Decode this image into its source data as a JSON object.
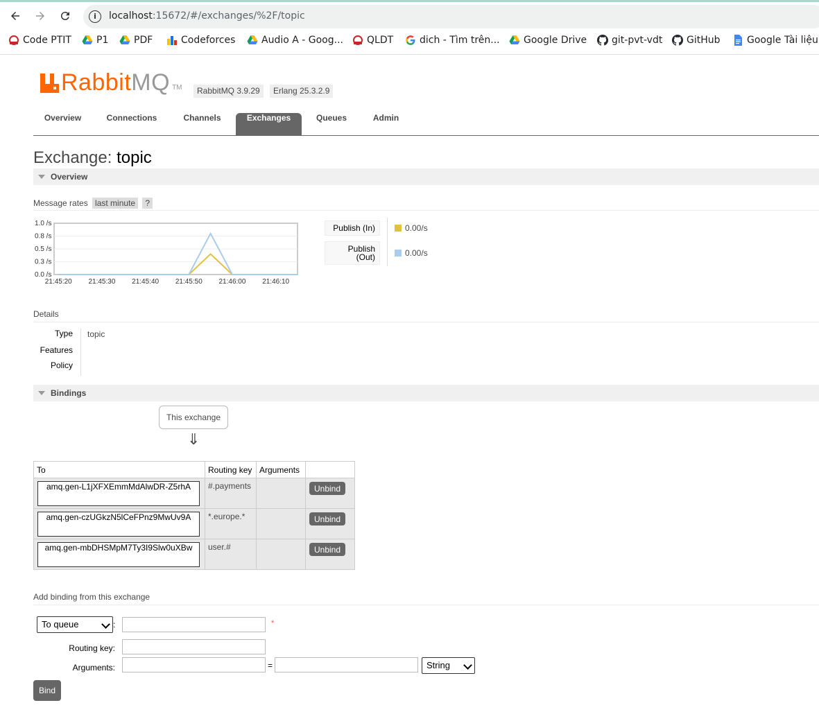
{
  "browser": {
    "url_host": "localhost",
    "url_rest": ":15672/#/exchanges/%2F/topic",
    "bookmarks": [
      {
        "label": "Code PTIT",
        "icon": "ptit-icon"
      },
      {
        "label": "P1",
        "icon": "google-drive-icon"
      },
      {
        "label": "PDF",
        "icon": "google-drive-icon"
      },
      {
        "label": "Codeforces",
        "icon": "codeforces-icon"
      },
      {
        "label": "Audio A - Goog...",
        "icon": "google-drive-icon"
      },
      {
        "label": "QLDT",
        "icon": "ptit-icon"
      },
      {
        "label": "dich - Tìm trên...",
        "icon": "google-icon"
      },
      {
        "label": "Google Drive",
        "icon": "google-drive-icon"
      },
      {
        "label": "git-pvt-vdt",
        "icon": "github-icon"
      },
      {
        "label": "GitHub",
        "icon": "github-icon"
      },
      {
        "label": "Google Tài liệu",
        "icon": "google-docs-icon"
      }
    ]
  },
  "header": {
    "logo_rabbit": "Rabbit",
    "logo_mq": "MQ",
    "logo_tm": "TM",
    "rabbitmq_version": "RabbitMQ 3.9.29",
    "erlang_version": "Erlang 25.3.2.9"
  },
  "tabs": [
    "Overview",
    "Connections",
    "Channels",
    "Exchanges",
    "Queues",
    "Admin"
  ],
  "active_tab": "Exchanges",
  "page_title_prefix": "Exchange: ",
  "page_title_name": "topic",
  "overview": {
    "section_label": "Overview",
    "message_rates_label": "Message rates",
    "range_label": "last minute",
    "help_label": "?",
    "publish_in_label": "Publish (In)",
    "publish_out_label_1": "Publish",
    "publish_out_label_2": "(Out)",
    "publish_in_value": "0.00/s",
    "publish_out_value": "0.00/s",
    "color_in": "#e0c240",
    "color_out": "#aaccee"
  },
  "chart_data": {
    "type": "line",
    "y_ticks": [
      "1.0 /s",
      "0.8 /s",
      "0.5 /s",
      "0.3 /s",
      "0.0 /s"
    ],
    "x_ticks": [
      "21:45:20",
      "21:45:30",
      "21:45:40",
      "21:45:50",
      "21:46:00",
      "21:46:10"
    ],
    "ylim": [
      0,
      1.0
    ],
    "x": [
      "21:45:20",
      "21:45:50",
      "21:45:55",
      "21:46:00",
      "21:46:15"
    ],
    "series": [
      {
        "name": "Publish (In)",
        "color": "#e0c240",
        "values": [
          0,
          0,
          0.4,
          0,
          0
        ]
      },
      {
        "name": "Publish (Out)",
        "color": "#aaccee",
        "values": [
          0,
          0,
          0.8,
          0,
          0
        ]
      }
    ]
  },
  "details": {
    "section_label": "Details",
    "type_label": "Type",
    "type_value": "topic",
    "features_label": "Features",
    "policy_label": "Policy"
  },
  "bindings": {
    "section_label": "Bindings",
    "this_exchange": "This exchange",
    "arrow": "⇓",
    "columns": [
      "To",
      "Routing key",
      "Arguments",
      ""
    ],
    "rows": [
      {
        "to": "amq.gen-L1jXFXEmmMdAlwDR-Z5rhA",
        "routing_key": "#.payments",
        "arguments": "",
        "action": "Unbind"
      },
      {
        "to": "amq.gen-czUGkzN5lCeFPnz9MwUv9A",
        "routing_key": "*.europe.*",
        "arguments": "",
        "action": "Unbind"
      },
      {
        "to": "amq.gen-mbDHSMpM7Ty3I9Slw0uXBw",
        "routing_key": "user.#",
        "arguments": "",
        "action": "Unbind"
      }
    ]
  },
  "add_binding": {
    "title": "Add binding from this exchange",
    "destination_type": "To queue",
    "required_mark": "*",
    "routing_key_label": "Routing key:",
    "arguments_label": "Arguments:",
    "equals": "=",
    "arg_type": "String",
    "bind_button": "Bind"
  }
}
